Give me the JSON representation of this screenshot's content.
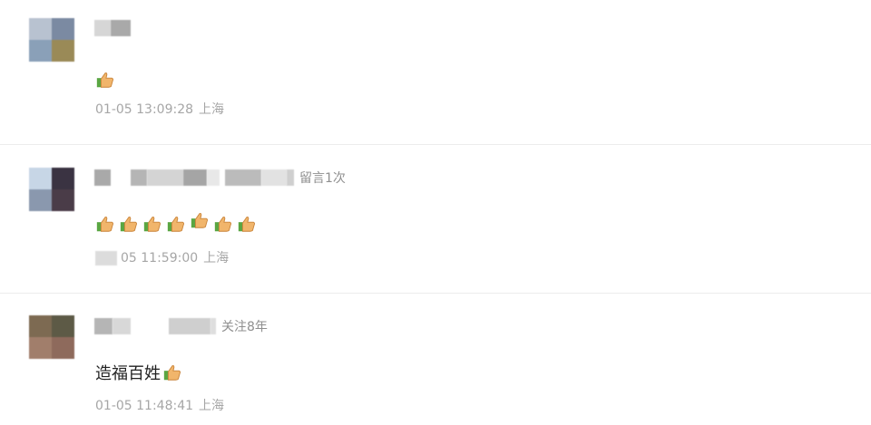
{
  "comments": [
    {
      "author_tag": "",
      "content_text": "",
      "reaction_count": 1,
      "time": "01-05 13:09:28",
      "location": "上海"
    },
    {
      "author_tag": "留言1次",
      "content_text": "",
      "reaction_count": 7,
      "time": "05 11:59:00",
      "location": "上海"
    },
    {
      "author_tag": "关注8年",
      "content_text": "造福百姓",
      "reaction_count": 1,
      "time": "01-05 11:48:41",
      "location": "上海"
    }
  ],
  "colors": {
    "meta_text": "#a6a6a6",
    "tag_text": "#8f8f8f",
    "divider": "#ececec"
  },
  "icons": {
    "reaction": "thumbs-up-icon"
  }
}
